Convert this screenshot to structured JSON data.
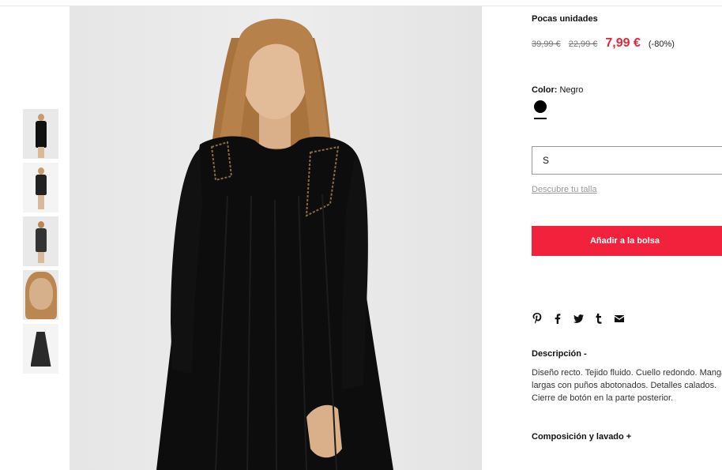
{
  "product": {
    "stock_status": "Pocas unidades",
    "prices": {
      "original": "39,99 €",
      "previous": "22,99 €",
      "current": "7,99 €",
      "discount": "(-80%)"
    },
    "color": {
      "label": "Color:",
      "value": "Negro",
      "swatch_hex": "#000000"
    },
    "size": {
      "selected": "S",
      "help_link": "Descubre tu talla"
    },
    "add_to_bag": "Añadir a la bolsa",
    "description": {
      "title": "Descripción -",
      "text": "Diseño recto. Tejido fluido. Cuello redondo. Mangas largas con puños abotonados. Detalles calados. Cierre de botón en la parte posterior."
    },
    "composition_title": "Composición y lavado +"
  },
  "share_icons": [
    "pinterest-icon",
    "facebook-icon",
    "twitter-icon",
    "tumblr-icon",
    "email-icon"
  ],
  "colors": {
    "accent": "#f2213c",
    "price_sale": "#e3263a"
  }
}
